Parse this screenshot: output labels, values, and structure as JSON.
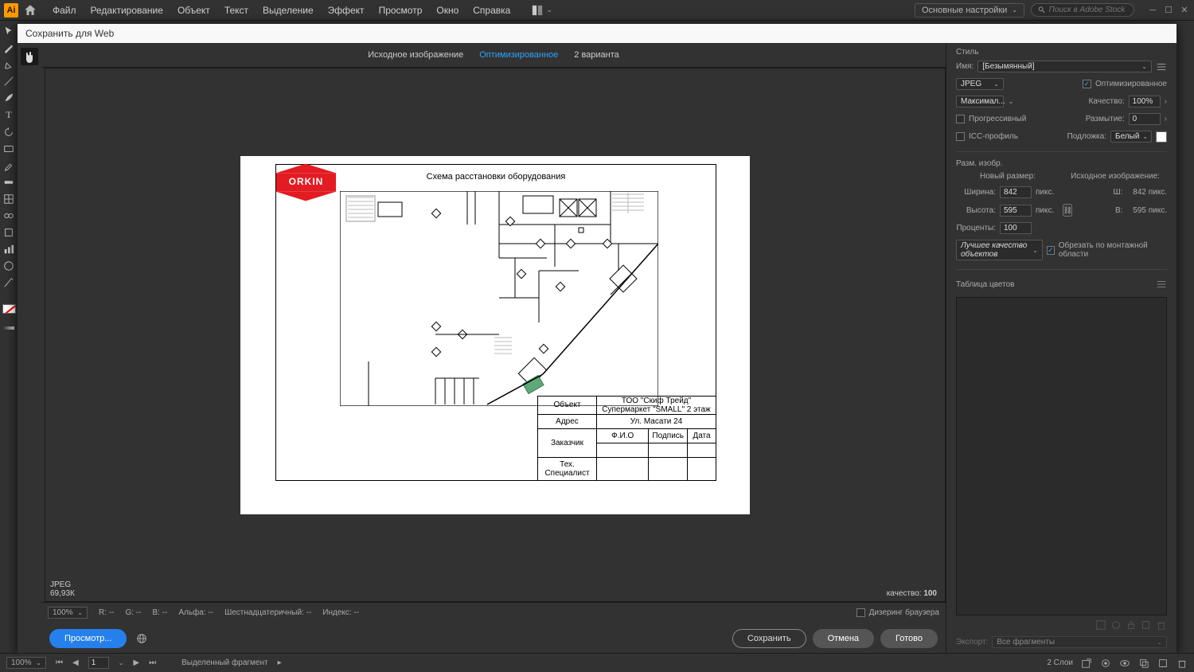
{
  "menu": {
    "file": "Файл",
    "edit": "Редактирование",
    "object": "Объект",
    "text": "Текст",
    "select": "Выделение",
    "effect": "Эффект",
    "view": "Просмотр",
    "window": "Окно",
    "help": "Справка"
  },
  "workspace": "Основные настройки",
  "search_ph": "Поиск в Adobe Stock",
  "dialog": {
    "title": "Сохранить для Web"
  },
  "tabs": {
    "original": "Исходное изображение",
    "optimized": "Оптимизированное",
    "two": "2 варианта"
  },
  "artboard": {
    "title": "Схема расстановки оборудования",
    "logo": "ORKIN"
  },
  "table": {
    "object_lbl": "Объект",
    "object_val1": "ТОО \"Скиф Трейд\"",
    "object_val2": "Супермаркет \"SMALL\" 2 этаж",
    "addr_lbl": "Адрес",
    "addr_val": "Ул. Масати 24",
    "fio": "Ф.И.О",
    "sign": "Подпись",
    "date": "Дата",
    "customer": "Заказчик",
    "tech": "Тех. Специалист"
  },
  "info": {
    "format": "JPEG",
    "size": "69,93К",
    "quality_lbl": "качество:",
    "quality_val": "100"
  },
  "panel": {
    "style": "Стиль",
    "name_lbl": "Имя:",
    "name_val": "[Безымянный]",
    "format": "JPEG",
    "optimized": "Оптимизированное",
    "preset": "Максимал...",
    "quality_lbl": "Качество:",
    "quality": "100%",
    "progressive": "Прогрессивный",
    "blur_lbl": "Размытие:",
    "blur": "0",
    "icc": "ICC-профиль",
    "matte_lbl": "Подложка:",
    "matte": "Белый",
    "imgsize": "Разм. изобр.",
    "newsize": "Новый размер:",
    "origimg": "Исходное изображение:",
    "w_lbl": "Ширина:",
    "w": "842",
    "h_lbl": "Высота:",
    "h": "595",
    "pct_lbl": "Проценты:",
    "pct": "100",
    "px": "пикс.",
    "ow_lbl": "Ш:",
    "ow": "842 пикс.",
    "oh_lbl": "В:",
    "oh": "595 пикс.",
    "quality_dd": "Лучшее качество объектов",
    "clip": "Обрезать по монтажной области",
    "colortable": "Таблица цветов",
    "export": "Экспорт:",
    "export_val": "Все фрагменты"
  },
  "status": {
    "zoom": "100%",
    "r": "R: --",
    "g": "G: --",
    "b": "B: --",
    "alpha": "Альфа: --",
    "hex": "Шестнадцатеричный: --",
    "index": "Индекс: --"
  },
  "footer": {
    "preview": "Просмотр...",
    "dither": "Дизеринг браузера",
    "save": "Сохранить",
    "cancel": "Отмена",
    "done": "Готово"
  },
  "app_footer": {
    "zoom": "100%",
    "page": "1",
    "selection": "Выделенный фрагмент",
    "layers": "2 Слои"
  }
}
